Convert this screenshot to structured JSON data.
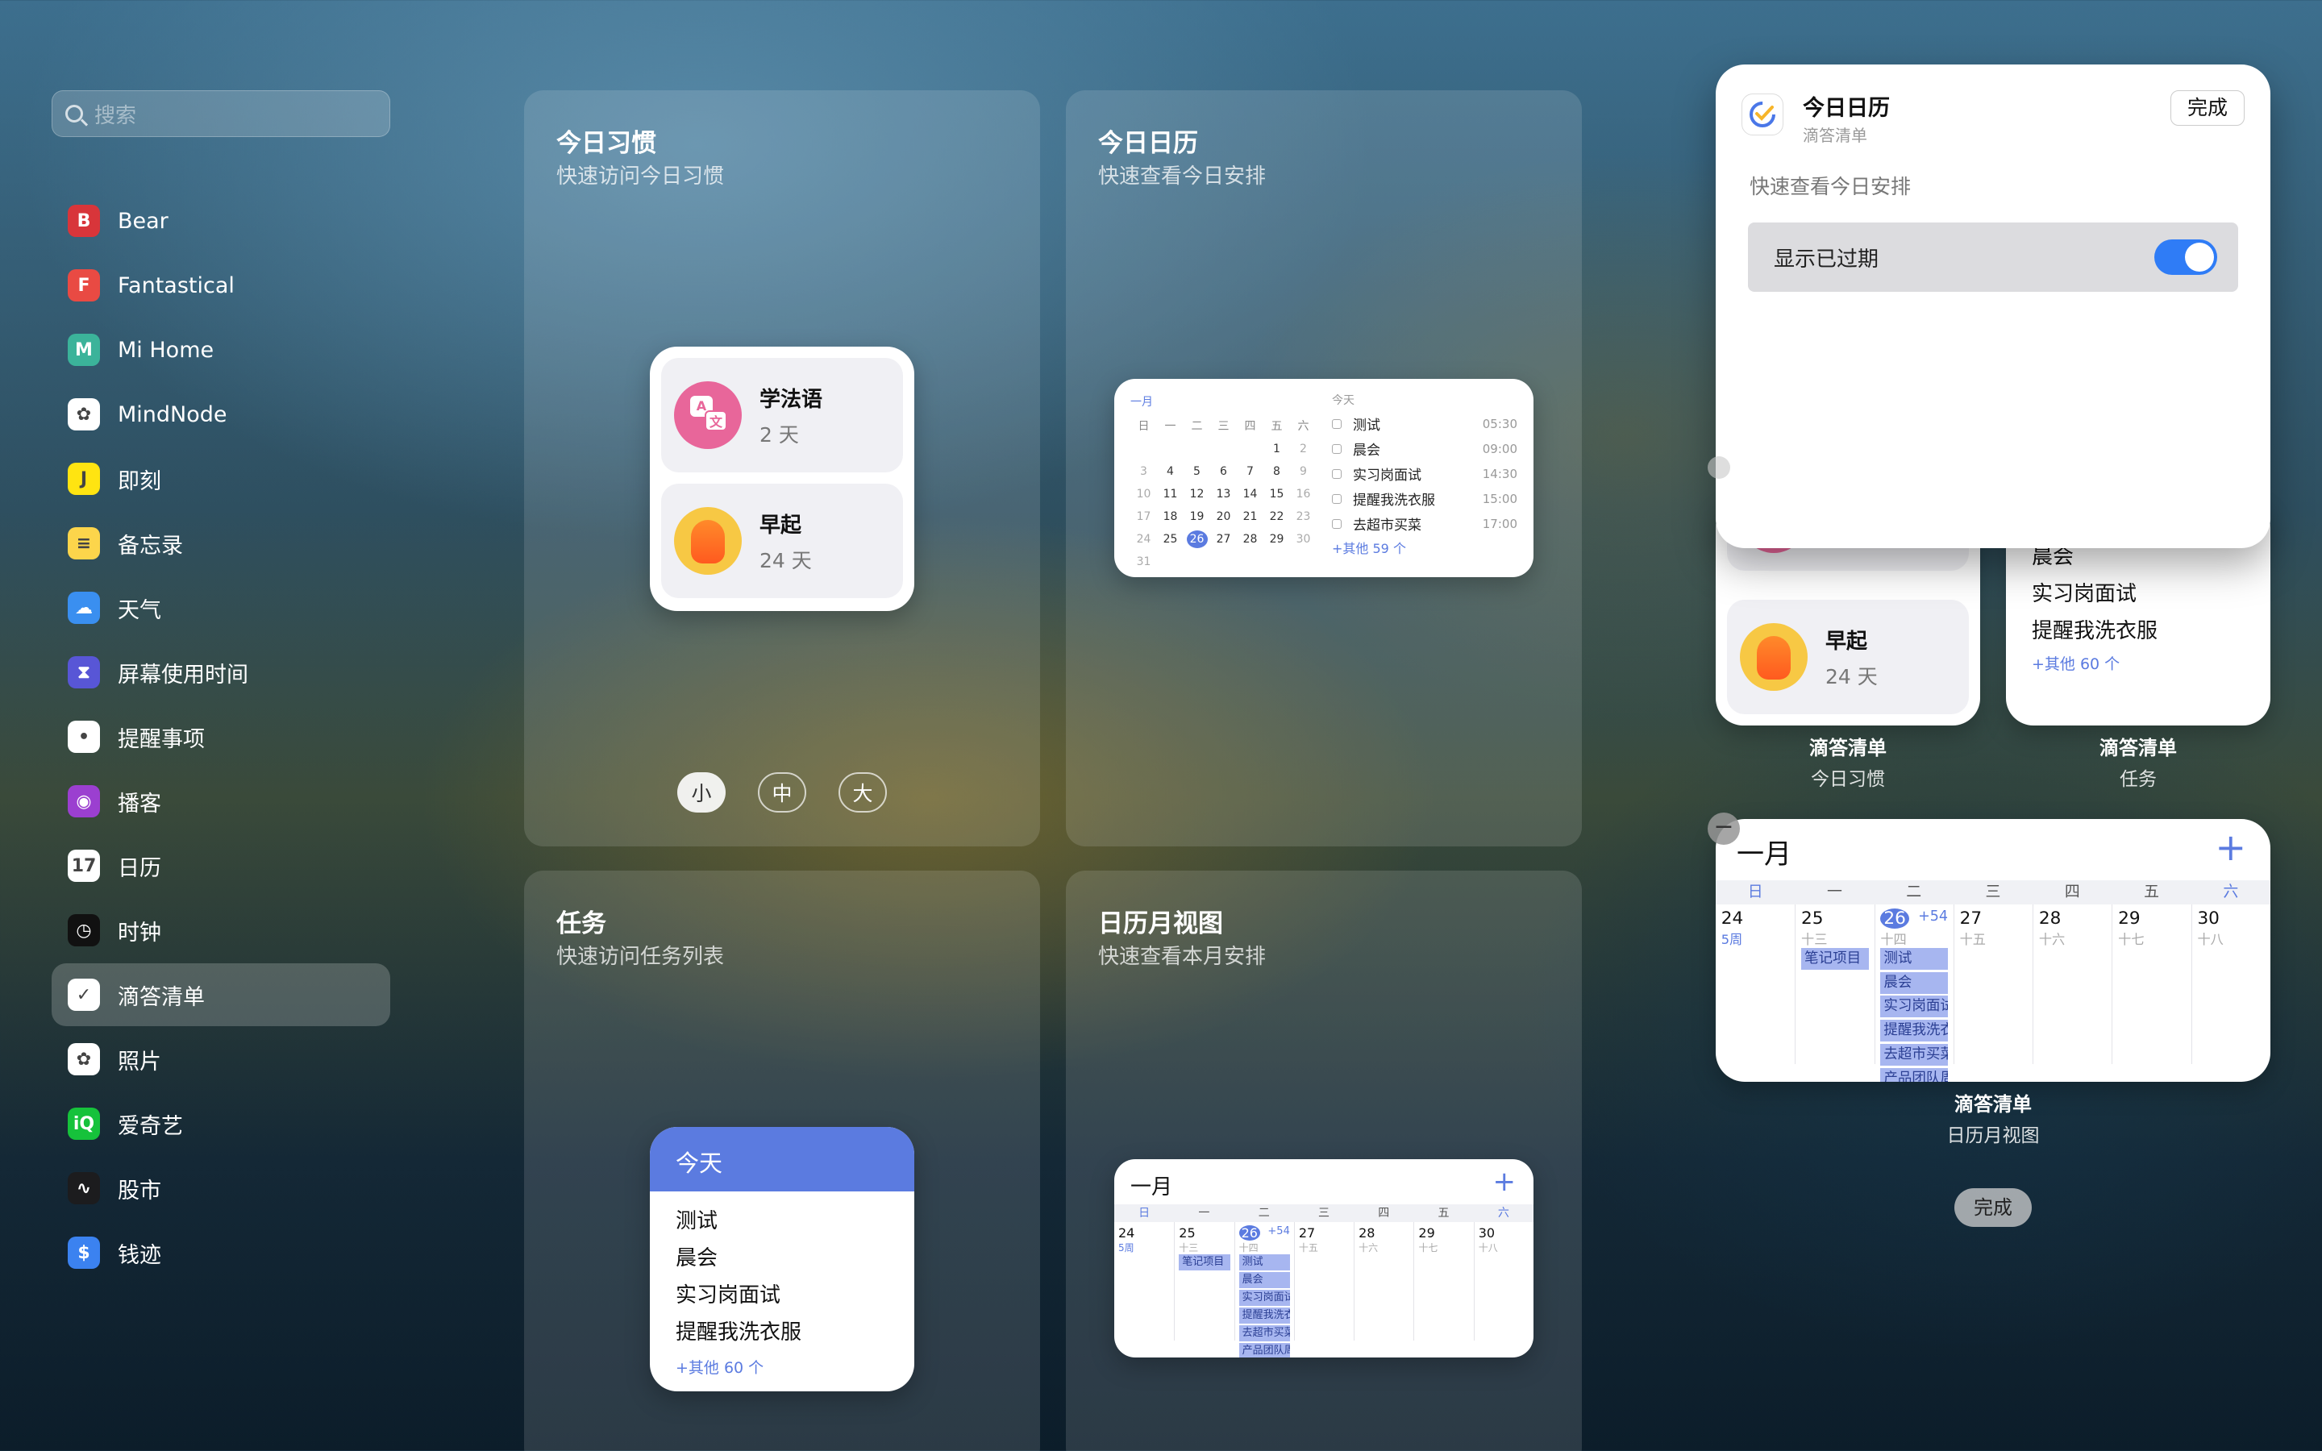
{
  "search": {
    "placeholder": "搜索"
  },
  "apps": [
    {
      "label": "Bear",
      "icon": "bear-icon",
      "color": "#d8353a",
      "glyph": "B"
    },
    {
      "label": "Fantastical",
      "icon": "fantastical-icon",
      "color": "#e94a43",
      "glyph": "F"
    },
    {
      "label": "Mi Home",
      "icon": "mi-home-icon",
      "color": "#3bb39a",
      "glyph": "M"
    },
    {
      "label": "MindNode",
      "icon": "mindnode-icon",
      "color": "#ffffff",
      "glyph": "✿"
    },
    {
      "label": "即刻",
      "icon": "jike-icon",
      "color": "#ffe411",
      "glyph": "J"
    },
    {
      "label": "备忘录",
      "icon": "notes-icon",
      "color": "#fcd54b",
      "glyph": "≡"
    },
    {
      "label": "天气",
      "icon": "weather-icon",
      "color": "#3a8ff0",
      "glyph": "☁"
    },
    {
      "label": "屏幕使用时间",
      "icon": "screen-time-icon",
      "color": "#5856d6",
      "glyph": "⧗"
    },
    {
      "label": "提醒事项",
      "icon": "reminders-icon",
      "color": "#ffffff",
      "glyph": "•"
    },
    {
      "label": "播客",
      "icon": "podcasts-icon",
      "color": "#9b3fd0",
      "glyph": "◉"
    },
    {
      "label": "日历",
      "icon": "calendar-icon",
      "color": "#ffffff",
      "glyph": "17"
    },
    {
      "label": "时钟",
      "icon": "clock-icon",
      "color": "#111111",
      "glyph": "◷"
    },
    {
      "label": "滴答清单",
      "icon": "ticktick-icon",
      "color": "#ffffff",
      "glyph": "✓"
    },
    {
      "label": "照片",
      "icon": "photos-icon",
      "color": "#ffffff",
      "glyph": "✿"
    },
    {
      "label": "爱奇艺",
      "icon": "iqiyi-icon",
      "color": "#16c23b",
      "glyph": "iQ"
    },
    {
      "label": "股市",
      "icon": "stocks-icon",
      "color": "#1c1c1e",
      "glyph": "∿"
    },
    {
      "label": "钱迹",
      "icon": "qianji-icon",
      "color": "#3b82f0",
      "glyph": "$"
    }
  ],
  "panels": {
    "habit": {
      "title": "今日习惯",
      "subtitle": "快速访问今日习惯"
    },
    "today_cal": {
      "title": "今日日历",
      "subtitle": "快速查看今日安排"
    },
    "tasks": {
      "title": "任务",
      "subtitle": "快速访问任务列表"
    },
    "month": {
      "title": "日历月视图",
      "subtitle": "快速查看本月安排"
    }
  },
  "habits": [
    {
      "name": "学法语",
      "days": "2 天"
    },
    {
      "name": "早起",
      "days": "24 天"
    }
  ],
  "sizes": [
    "小",
    "中",
    "大"
  ],
  "mini_cal": {
    "month": "一月",
    "today": "今天",
    "weekdays": [
      "日",
      "一",
      "二",
      "三",
      "四",
      "五",
      "六"
    ],
    "days": [
      "",
      "",
      "",
      "",
      "",
      "1",
      "2",
      "3",
      "4",
      "5",
      "6",
      "7",
      "8",
      "9",
      "10",
      "11",
      "12",
      "13",
      "14",
      "15",
      "16",
      "17",
      "18",
      "19",
      "20",
      "21",
      "22",
      "23",
      "24",
      "25",
      "26",
      "27",
      "28",
      "29",
      "30",
      "31"
    ],
    "more": "+其他 59 个"
  },
  "schedule": [
    {
      "name": "测试",
      "time": "05:30"
    },
    {
      "name": "晨会",
      "time": "09:00"
    },
    {
      "name": "实习岗面试",
      "time": "14:30"
    },
    {
      "name": "提醒我洗衣服",
      "time": "15:00"
    },
    {
      "name": "去超市买菜",
      "time": "17:00"
    }
  ],
  "task_widget": {
    "header": "今天",
    "items": [
      "测试",
      "晨会",
      "实习岗面试",
      "提醒我洗衣服"
    ],
    "more": "+其他 60 个"
  },
  "month_widget": {
    "title": "一月",
    "weekdays": [
      "日",
      "一",
      "二",
      "三",
      "四",
      "五",
      "六"
    ],
    "days": [
      {
        "n": "24",
        "s": "5周"
      },
      {
        "n": "25",
        "s": "十三"
      },
      {
        "n": "26",
        "s": "十四",
        "extra": "+54"
      },
      {
        "n": "27",
        "s": "十五"
      },
      {
        "n": "28",
        "s": "十六"
      },
      {
        "n": "29",
        "s": "十七"
      },
      {
        "n": "30",
        "s": "十八"
      }
    ],
    "note": "笔记项目",
    "events": [
      "测试",
      "晨会",
      "实习岗面试",
      "提醒我洗衣服",
      "去超市买菜",
      "产品团队周会"
    ]
  },
  "config": {
    "title": "今日日历",
    "subtitle": "滴答清单",
    "done": "完成",
    "desc": "快速查看今日安排",
    "toggle_label": "显示已过期",
    "toggle_on": true
  },
  "right_captions": {
    "habit": {
      "app": "滴答清单",
      "name": "今日习惯"
    },
    "tasks": {
      "app": "滴答清单",
      "name": "任务"
    },
    "month": {
      "app": "滴答清单",
      "name": "日历月视图"
    }
  },
  "done_button": "完成",
  "colors": {
    "accent": "#5b7be0",
    "toggle": "#2f7cf6",
    "task_header": "#5b7be0"
  }
}
